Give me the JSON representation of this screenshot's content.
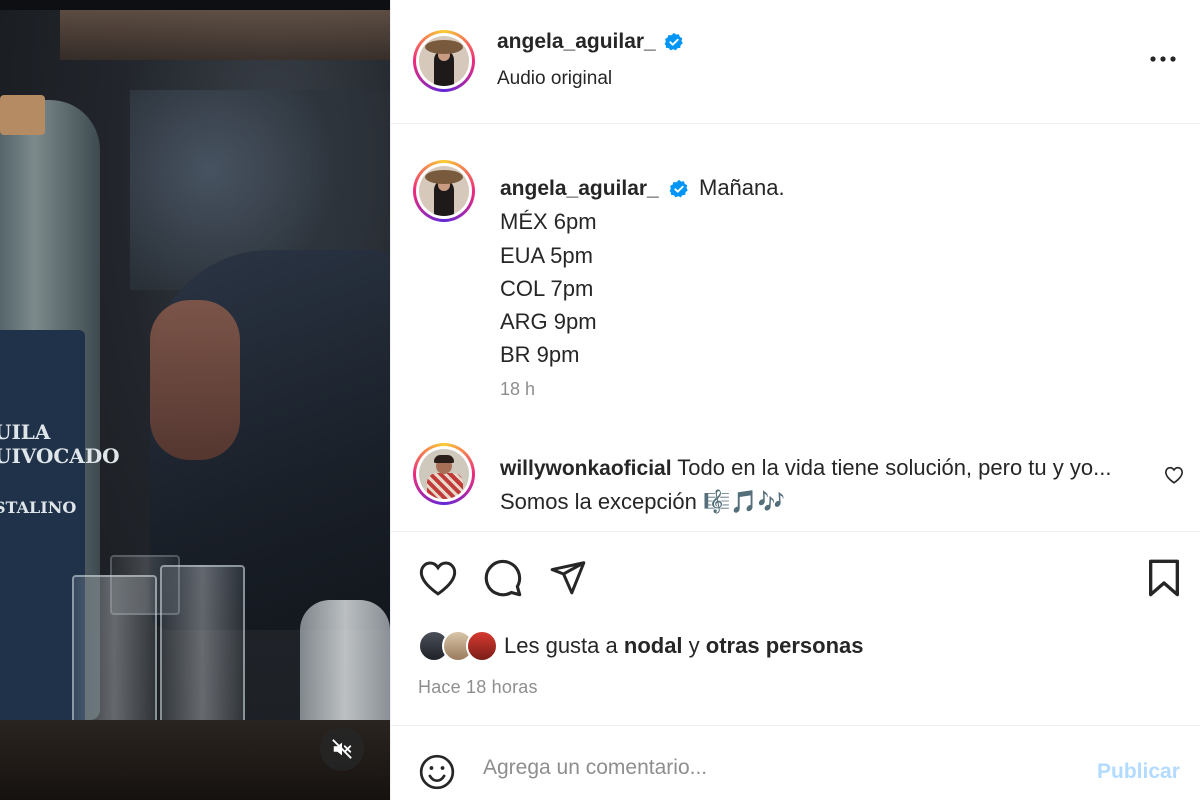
{
  "post": {
    "author": "angela_aguilar_",
    "audio_label": "Audio original",
    "more_icon": "more-horizontal-icon",
    "verified_icon": "verified-badge-icon"
  },
  "caption": {
    "author": "angela_aguilar_",
    "lines": [
      "Mañana.",
      "MÉX 6pm",
      "EUA 5pm",
      "COL 7pm",
      "ARG 9pm",
      "BR 9pm"
    ],
    "time": "18 h"
  },
  "comment": {
    "author": "willywonkaoficial",
    "text_line1": "Todo en la vida tiene solución, pero tu y yo...",
    "text_line2": "Somos la excepción 🎼🎵🎶"
  },
  "media": {
    "label_text": [
      "UILA",
      "UIVOCADO",
      "STALINO"
    ],
    "mute_icon": "speaker-muted-icon"
  },
  "likes": {
    "prefix": "Les gusta a ",
    "user": "nodal",
    "joiner": " y ",
    "others": "otras personas"
  },
  "timestamp": "Hace 18 horas",
  "composer": {
    "placeholder": "Agrega un comentario...",
    "post_label": "Publicar"
  },
  "colors": {
    "verified": "#0095f6",
    "post_disabled": "#b3dbff",
    "muted_text": "#8e8e8e"
  }
}
